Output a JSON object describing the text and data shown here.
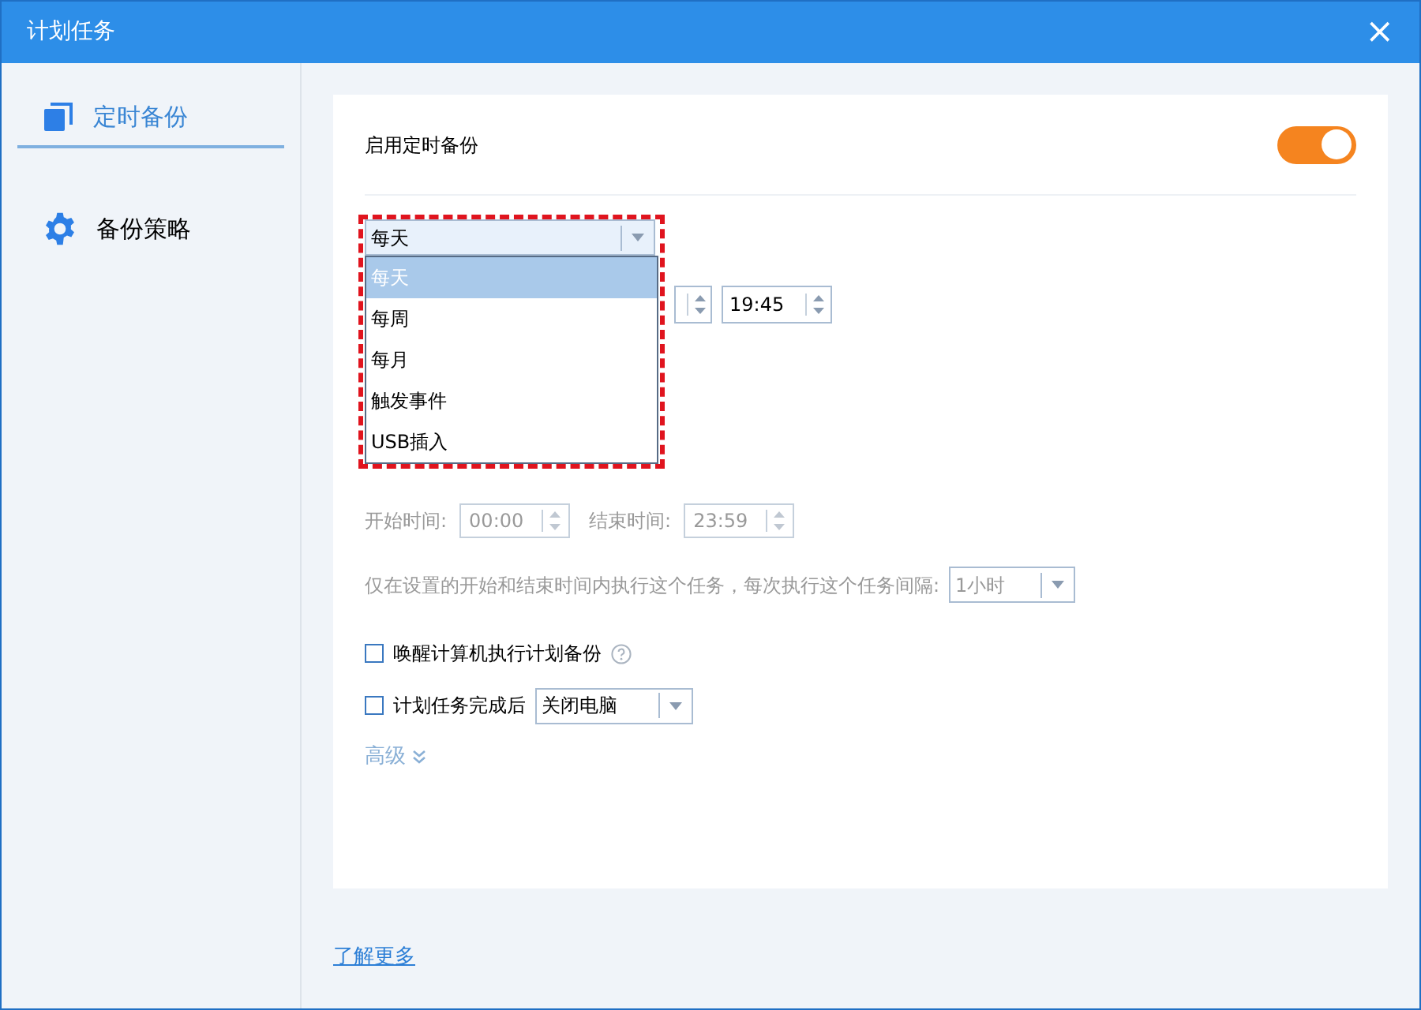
{
  "window": {
    "title": "计划任务",
    "close": "×"
  },
  "sidebar": {
    "items": [
      {
        "label": "定时备份",
        "selected": true
      },
      {
        "label": "备份策略",
        "selected": false
      }
    ]
  },
  "settings": {
    "enable_label": "启用定时备份",
    "enable_on": true,
    "frequency": {
      "value": "每天",
      "expanded": true,
      "options": [
        {
          "label": "每天",
          "selected": true
        },
        {
          "label": "每周",
          "selected": false
        },
        {
          "label": "每月",
          "selected": false
        },
        {
          "label": "触发事件",
          "selected": false
        },
        {
          "label": "USB插入",
          "selected": false
        }
      ]
    },
    "time": "19:45",
    "start_label": "开始时间:",
    "start_value": "00:00",
    "end_label": "结束时间:",
    "end_value": "23:59",
    "range_disabled": true,
    "interval_text": "仅在设置的开始和结束时间内执行这个任务，每次执行这个任务间隔:",
    "interval_value": "1小时",
    "checks": [
      {
        "label": "唤醒计算机执行计划备份",
        "checked": false,
        "kind": "help"
      },
      {
        "label": "计划任务完成后",
        "checked": false,
        "kind": "select",
        "value": "关闭电脑"
      }
    ],
    "advanced": "高级"
  },
  "footer": {
    "link": "了解更多"
  }
}
